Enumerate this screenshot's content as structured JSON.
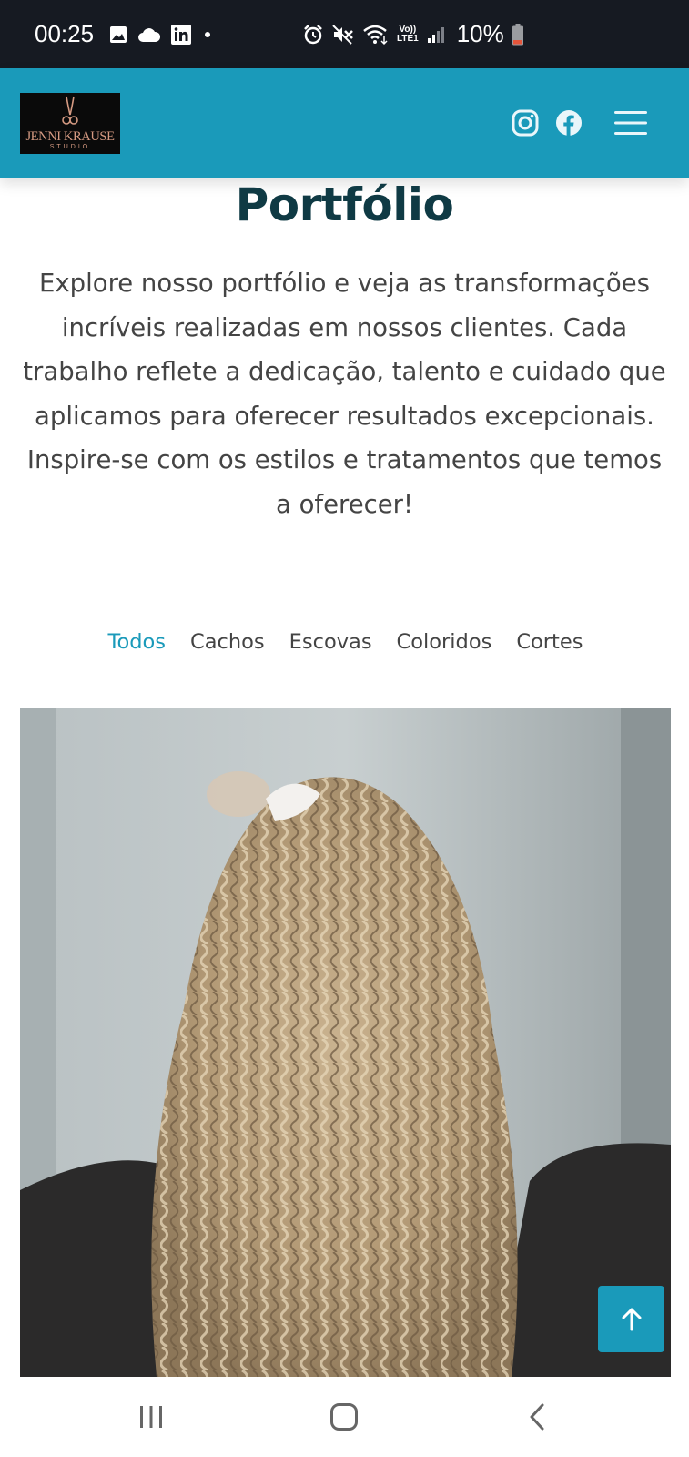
{
  "status_bar": {
    "time": "00:25",
    "battery": "10%",
    "icons": [
      "image-icon",
      "cloud-icon",
      "linkedin-icon",
      "dot-icon",
      "alarm-icon",
      "mute-icon",
      "wifi-icon",
      "volte-icon",
      "signal-icon",
      "battery-icon"
    ],
    "network_label_top": "Vo))",
    "network_label_bottom": "LTE1",
    "battery_low_color": "#e5553b"
  },
  "header": {
    "logo_name": "JENNI KRAUSE",
    "logo_sub": "STUDIO",
    "icons": [
      "instagram-icon",
      "facebook-icon",
      "hamburger-menu-icon"
    ],
    "brand_color": "#1a9aba"
  },
  "page": {
    "title": "Portfólio",
    "intro": "Explore nosso portfólio e veja as transformações incríveis realizadas em nossos clientes. Cada trabalho reflete a dedicação, talento e cuidado que aplicamos para oferecer resultados excepcionais. Inspire-se com os estilos e tratamentos que temos a oferecer!"
  },
  "filters": {
    "items": [
      "Todos",
      "Cachos",
      "Escovas",
      "Coloridos",
      "Cortes"
    ],
    "active": "Todos"
  },
  "portfolio": {
    "photo_subject": "curly-blonde-hair-back-view"
  },
  "back_to_top": {
    "icon": "arrow-up-icon"
  },
  "nav_bar": {
    "icons": [
      "recent-apps-icon",
      "home-icon",
      "back-icon"
    ]
  }
}
